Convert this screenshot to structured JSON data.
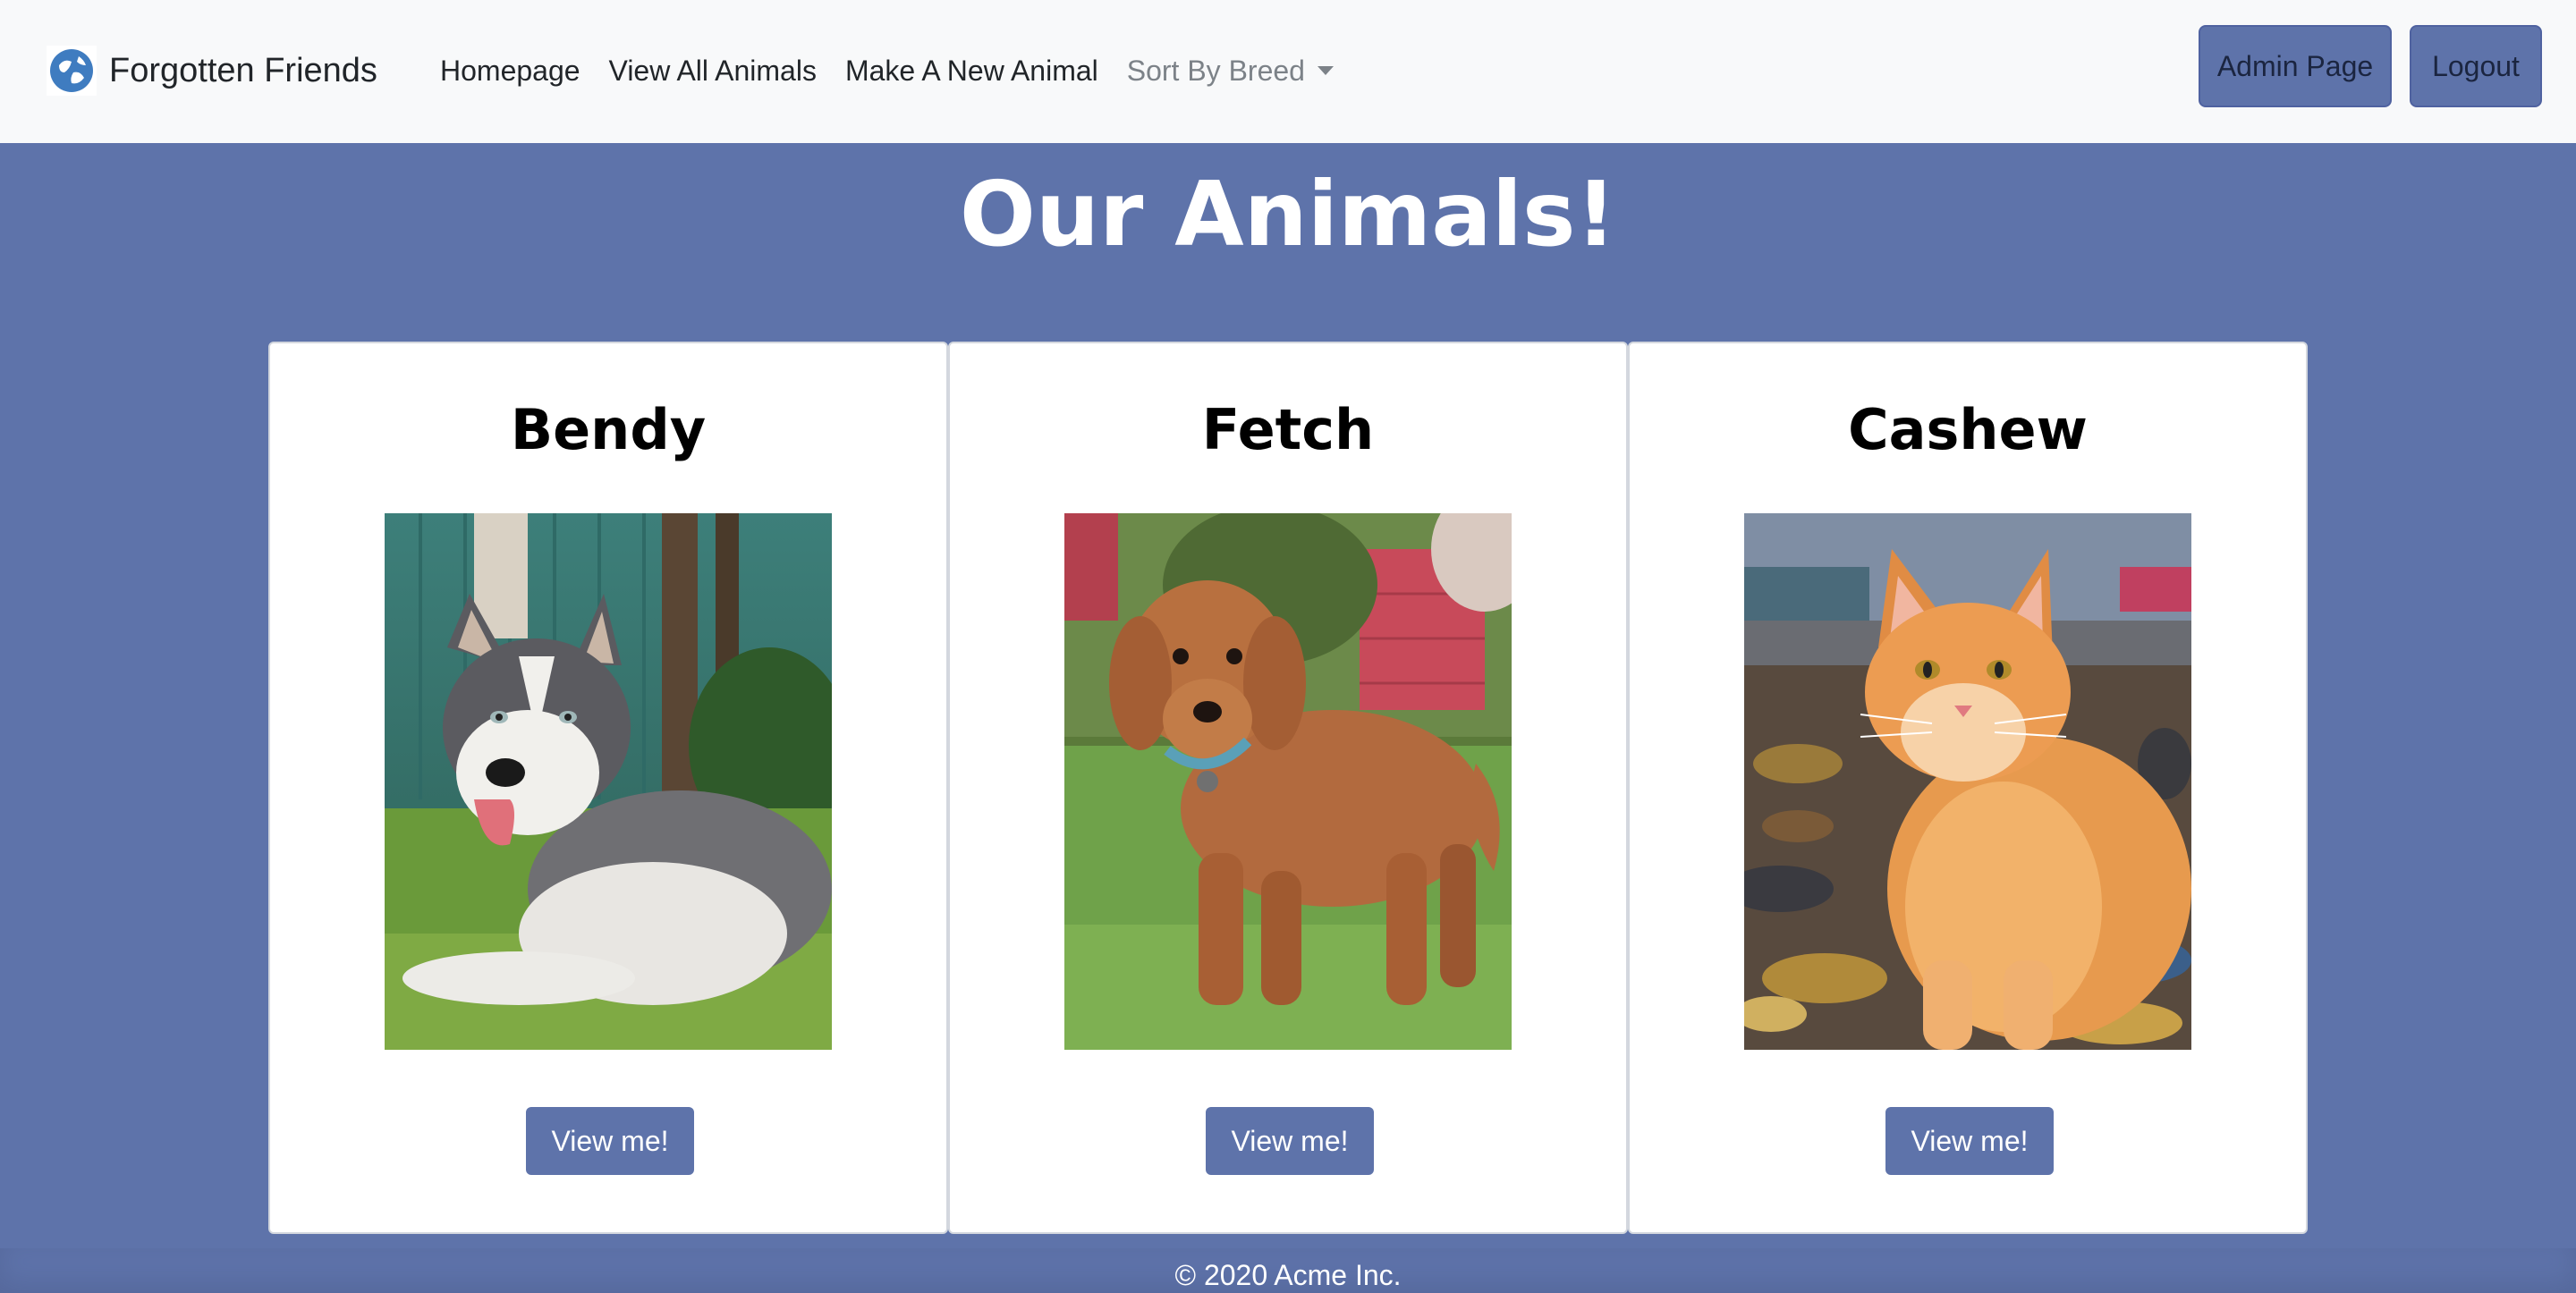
{
  "navbar": {
    "brand": "Forgotten Friends",
    "brand_icon": "globe-heart-icon",
    "links": [
      "Homepage",
      "View All Animals",
      "Make A New Animal"
    ],
    "dropdown_label": "Sort By Breed",
    "admin_label": "Admin Page",
    "logout_label": "Logout"
  },
  "page": {
    "title": "Our Animals!"
  },
  "cards": [
    {
      "name": "Bendy",
      "button": "View me!"
    },
    {
      "name": "Fetch",
      "button": "View me!"
    },
    {
      "name": "Cashew",
      "button": "View me!"
    }
  ],
  "footer": {
    "text": "© 2020 Acme Inc."
  },
  "colors": {
    "accent": "#5e73aa",
    "navbar_bg": "#f8f9fa",
    "card_bg": "#ffffff"
  }
}
